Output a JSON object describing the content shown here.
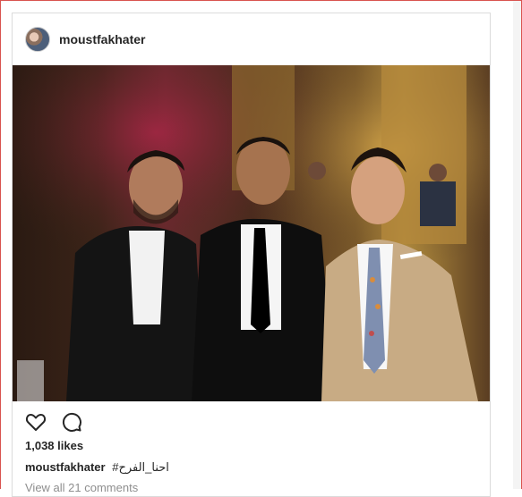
{
  "post": {
    "username": "moustfakhater",
    "likes": "1,038 likes",
    "caption_user": "moustfakhater",
    "caption_text": "#احنا_الفرح",
    "comments_link": "View all 21 comments"
  },
  "icons": {
    "like": "heart-icon",
    "comment": "comment-icon",
    "avatar": "avatar"
  },
  "colors": {
    "text": "#262626",
    "muted": "#8e8e8e",
    "border": "#dbdbdb"
  }
}
